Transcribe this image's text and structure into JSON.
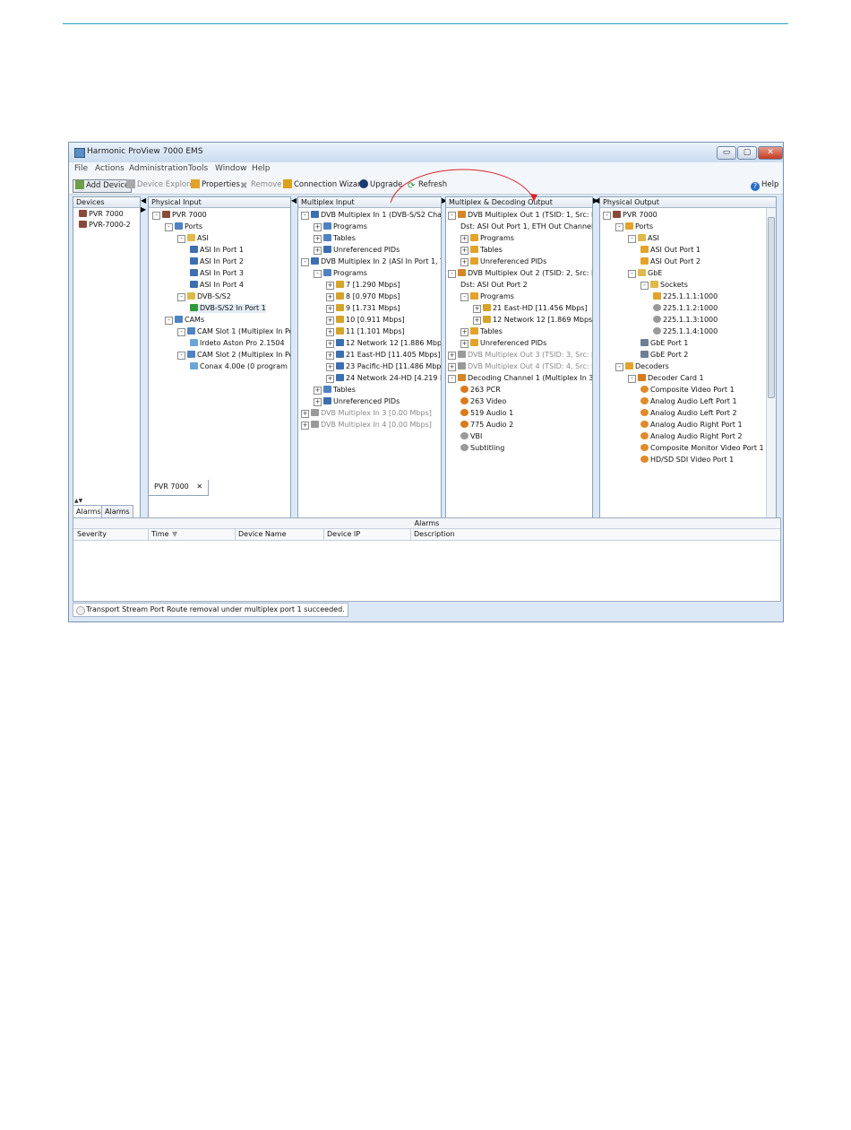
{
  "window": {
    "title": "Harmonic ProView 7000 EMS",
    "controls": {
      "minimize": "▭",
      "maximize": "▢",
      "close": "✕"
    }
  },
  "menubar": [
    "File",
    "Actions",
    "Administration",
    "Tools",
    "Window",
    "Help"
  ],
  "toolbar": {
    "add_device": "Add Device",
    "device_explorer": "Device Explorer",
    "properties": "Properties",
    "remove": "Remove",
    "connection_wizard": "Connection Wizard",
    "upgrade": "Upgrade",
    "refresh": "Refresh",
    "help": "Help"
  },
  "devices": {
    "header": "Devices",
    "items": [
      "PVR 7000",
      "PVR-7000-2"
    ]
  },
  "physical_input": {
    "header": "Physical Input",
    "nodes": [
      {
        "label": "PVR 7000",
        "indent": 0,
        "exp": "-",
        "icon": "device-icon"
      },
      {
        "label": "Ports",
        "indent": 1,
        "exp": "-",
        "icon": "ports-icon"
      },
      {
        "label": "ASI",
        "indent": 2,
        "exp": "-",
        "icon": "folder-icon"
      },
      {
        "label": "ASI In Port 1",
        "indent": 3,
        "exp": "",
        "icon": "asi-port-icon"
      },
      {
        "label": "ASI In Port 2",
        "indent": 3,
        "exp": "",
        "icon": "asi-port-icon"
      },
      {
        "label": "ASI In Port 3",
        "indent": 3,
        "exp": "",
        "icon": "asi-port-icon"
      },
      {
        "label": "ASI In Port 4",
        "indent": 3,
        "exp": "",
        "icon": "asi-port-icon"
      },
      {
        "label": "DVB-S/S2",
        "indent": 2,
        "exp": "-",
        "icon": "folder-icon"
      },
      {
        "label": "DVB-S/S2 In Port 1",
        "indent": 3,
        "exp": "",
        "icon": "satellite-port-icon",
        "selected": true
      },
      {
        "label": "CAMs",
        "indent": 1,
        "exp": "-",
        "icon": "ports-icon"
      },
      {
        "label": "CAM Slot 1 (Multiplex In Port",
        "indent": 2,
        "exp": "-",
        "icon": "cam-slot-icon"
      },
      {
        "label": "Irdeto Aston Pro 2.1504",
        "indent": 3,
        "exp": "",
        "icon": "cam-card-icon"
      },
      {
        "label": "CAM Slot 2 (Multiplex In Port",
        "indent": 2,
        "exp": "-",
        "icon": "cam-slot-icon"
      },
      {
        "label": "Conax 4.00e (0 program",
        "indent": 3,
        "exp": "",
        "icon": "cam-card-icon"
      }
    ]
  },
  "multiplex_input": {
    "header": "Multiplex Input",
    "nodes": [
      {
        "label": "DVB Multiplex In 1 (DVB-S/S2 Channel",
        "indent": 0,
        "exp": "-",
        "icon": "multiplex-icon"
      },
      {
        "label": "Programs",
        "indent": 1,
        "exp": "+",
        "icon": "ports-icon"
      },
      {
        "label": "Tables",
        "indent": 1,
        "exp": "+",
        "icon": "table-icon"
      },
      {
        "label": "Unreferenced PIDs",
        "indent": 1,
        "exp": "+",
        "icon": "pid-icon"
      },
      {
        "label": "DVB Multiplex In 2 (ASI In Port 1, TSID",
        "indent": 0,
        "exp": "-",
        "icon": "multiplex-icon"
      },
      {
        "label": "Programs",
        "indent": 1,
        "exp": "-",
        "icon": "ports-icon"
      },
      {
        "label": "7 [1.290 Mbps]",
        "indent": 2,
        "exp": "+",
        "icon": "program-icon"
      },
      {
        "label": "8 [0.970 Mbps]",
        "indent": 2,
        "exp": "+",
        "icon": "program-icon"
      },
      {
        "label": "9 [1.731 Mbps]",
        "indent": 2,
        "exp": "+",
        "icon": "program-icon"
      },
      {
        "label": "10 [0.911 Mbps]",
        "indent": 2,
        "exp": "+",
        "icon": "program-icon"
      },
      {
        "label": "11 [1.101 Mbps]",
        "indent": 2,
        "exp": "+",
        "icon": "program-icon"
      },
      {
        "label": "12 Network 12 [1.886 Mbps]",
        "indent": 2,
        "exp": "+",
        "icon": "tv-program-icon"
      },
      {
        "label": "21 East-HD [11.405 Mbps]",
        "indent": 2,
        "exp": "+",
        "icon": "tv-program-icon"
      },
      {
        "label": "23 Pacific-HD [11.486 Mbps]",
        "indent": 2,
        "exp": "+",
        "icon": "tv-program-icon"
      },
      {
        "label": "24 Network 24-HD [4.219 Mbp",
        "indent": 2,
        "exp": "+",
        "icon": "tv-program-icon"
      },
      {
        "label": "Tables",
        "indent": 1,
        "exp": "+",
        "icon": "table-icon"
      },
      {
        "label": "Unreferenced PIDs",
        "indent": 1,
        "exp": "+",
        "icon": "pid-icon"
      },
      {
        "label": "DVB Multiplex In 3 [0.00 Mbps]",
        "indent": 0,
        "exp": "+",
        "icon": "multiplex-gray-icon",
        "gray": true
      },
      {
        "label": "DVB Multiplex In 4 [0.00 Mbps]",
        "indent": 0,
        "exp": "+",
        "icon": "multiplex-gray-icon",
        "gray": true
      }
    ]
  },
  "multiplex_output": {
    "header": "Multiplex & Decoding Output",
    "nodes": [
      {
        "label": "DVB Multiplex Out 1 (TSID: 1, Src: None",
        "indent": 0,
        "exp": "-",
        "icon": "multiplex-out-icon"
      },
      {
        "label": "Dst: ASI Out Port 1, ETH Out Channel 1",
        "indent": 1,
        "exp": "",
        "icon": ""
      },
      {
        "label": "Programs",
        "indent": 1,
        "exp": "+",
        "icon": "out-folder-icon"
      },
      {
        "label": "Tables",
        "indent": 1,
        "exp": "+",
        "icon": "out-table-icon"
      },
      {
        "label": "Unreferenced PIDs",
        "indent": 1,
        "exp": "+",
        "icon": "out-pid-icon"
      },
      {
        "label": "DVB Multiplex Out 2 (TSID: 2, Src: Multi",
        "indent": 0,
        "exp": "-",
        "icon": "multiplex-out-icon"
      },
      {
        "label": "Dst: ASI Out Port 2",
        "indent": 1,
        "exp": "",
        "icon": ""
      },
      {
        "label": "Programs",
        "indent": 1,
        "exp": "-",
        "icon": "out-folder-icon"
      },
      {
        "label": "21 East-HD [11.456 Mbps]",
        "indent": 2,
        "exp": "+",
        "icon": "out-program-icon"
      },
      {
        "label": "12 Network 12 [1.869 Mbps]",
        "indent": 2,
        "exp": "+",
        "icon": "out-program-icon"
      },
      {
        "label": "Tables",
        "indent": 1,
        "exp": "+",
        "icon": "out-table-icon"
      },
      {
        "label": "Unreferenced PIDs",
        "indent": 1,
        "exp": "+",
        "icon": "out-pid-icon"
      },
      {
        "label": "DVB Multiplex Out 3 (TSID: 3, Src: None",
        "indent": 0,
        "exp": "+",
        "icon": "multiplex-gray-icon",
        "gray": true
      },
      {
        "label": "DVB Multiplex Out 4 (TSID: 4, Src: None",
        "indent": 0,
        "exp": "+",
        "icon": "multiplex-gray-icon",
        "gray": true
      },
      {
        "label": "Decoding Channel 1 (Multiplex In 3, Pro",
        "indent": 0,
        "exp": "-",
        "icon": "decoder-channel-icon"
      },
      {
        "label": "263 PCR",
        "indent": 1,
        "exp": "",
        "icon": "gear-icon"
      },
      {
        "label": "263 Video",
        "indent": 1,
        "exp": "",
        "icon": "gear-icon"
      },
      {
        "label": "519 Audio 1",
        "indent": 1,
        "exp": "",
        "icon": "gear-icon"
      },
      {
        "label": "775 Audio 2",
        "indent": 1,
        "exp": "",
        "icon": "gear-icon"
      },
      {
        "label": "VBI",
        "indent": 1,
        "exp": "",
        "icon": "gear-gray-icon"
      },
      {
        "label": "Subtitling",
        "indent": 1,
        "exp": "",
        "icon": "gear-gray-icon"
      }
    ]
  },
  "physical_output": {
    "header": "Physical Output",
    "nodes": [
      {
        "label": "PVR 7000",
        "indent": 0,
        "exp": "-",
        "icon": "device-icon"
      },
      {
        "label": "Ports",
        "indent": 1,
        "exp": "-",
        "icon": "out-folder-icon"
      },
      {
        "label": "ASI",
        "indent": 2,
        "exp": "-",
        "icon": "folder-icon"
      },
      {
        "label": "ASI Out Port 1",
        "indent": 3,
        "exp": "",
        "icon": "asi-out-icon"
      },
      {
        "label": "ASI Out Port 2",
        "indent": 3,
        "exp": "",
        "icon": "asi-out-icon"
      },
      {
        "label": "GbE",
        "indent": 2,
        "exp": "-",
        "icon": "folder-icon"
      },
      {
        "label": "Sockets",
        "indent": 3,
        "exp": "-",
        "icon": "folder-icon"
      },
      {
        "label": "225.1.1.1:1000",
        "indent": 4,
        "exp": "",
        "icon": "socket-active-icon"
      },
      {
        "label": "225.1.1.2:1000",
        "indent": 4,
        "exp": "",
        "icon": "gear-gray-icon"
      },
      {
        "label": "225.1.1.3:1000",
        "indent": 4,
        "exp": "",
        "icon": "gear-gray-icon"
      },
      {
        "label": "225.1.1.4:1000",
        "indent": 4,
        "exp": "",
        "icon": "gear-gray-icon"
      },
      {
        "label": "GbE Port 1",
        "indent": 3,
        "exp": "",
        "icon": "gbe-port-icon"
      },
      {
        "label": "GbE Port 2",
        "indent": 3,
        "exp": "",
        "icon": "gbe-port-icon"
      },
      {
        "label": "Decoders",
        "indent": 1,
        "exp": "-",
        "icon": "out-folder-icon"
      },
      {
        "label": "Decoder Card 1",
        "indent": 2,
        "exp": "-",
        "icon": "decoder-card-icon"
      },
      {
        "label": "Composite Video Port 1",
        "indent": 3,
        "exp": "",
        "icon": "decoder-port-icon"
      },
      {
        "label": "Analog Audio Left Port 1",
        "indent": 3,
        "exp": "",
        "icon": "decoder-port-icon"
      },
      {
        "label": "Analog Audio Left Port 2",
        "indent": 3,
        "exp": "",
        "icon": "decoder-port-icon"
      },
      {
        "label": "Analog Audio Right Port 1",
        "indent": 3,
        "exp": "",
        "icon": "decoder-port-icon"
      },
      {
        "label": "Analog Audio Right Port 2",
        "indent": 3,
        "exp": "",
        "icon": "decoder-port-icon"
      },
      {
        "label": "Composite Monitor Video Port 1",
        "indent": 3,
        "exp": "",
        "icon": "decoder-port-icon"
      },
      {
        "label": "HD/SD SDI Video Port 1",
        "indent": 3,
        "exp": "",
        "icon": "decoder-port-icon"
      }
    ]
  },
  "device_tab": {
    "label": "PVR 7000",
    "close": "✕"
  },
  "alarms": {
    "tabs": [
      "Alarms",
      "Alarms History"
    ],
    "title": "Alarms",
    "columns": [
      "Severity",
      "Time",
      "Device Name",
      "Device IP",
      "Description"
    ],
    "sort_indicator": "▼"
  },
  "status": "Transport Stream Port Route removal under multiplex port 1 succeeded.",
  "colors": {
    "accent_line": "#29a3c7",
    "annotation_arrow": "#d9262c",
    "window_frame": "#dce8f5"
  }
}
